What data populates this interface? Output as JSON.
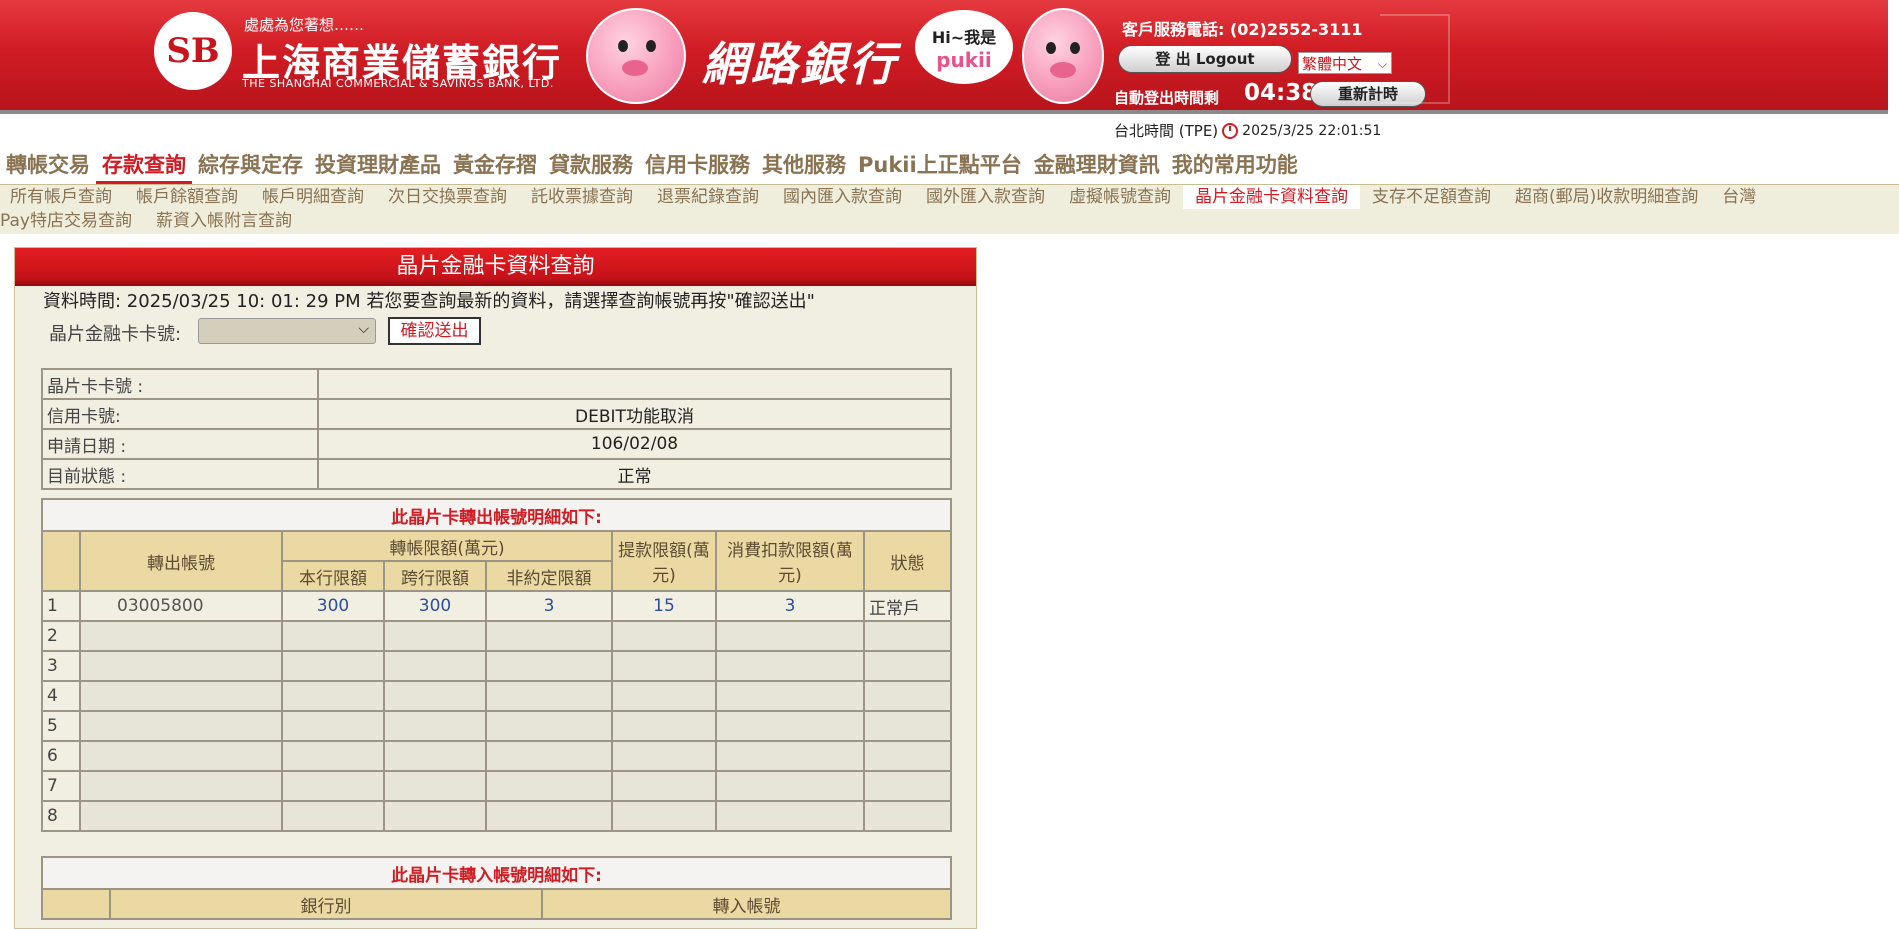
{
  "banner": {
    "logo_mark": "SB",
    "slogan": "處處為您著想……",
    "bank_name_zh": "上海商業儲蓄銀行",
    "bank_name_en": "THE SHANGHAI COMMERCIAL & SAVINGS BANK, LTD.",
    "netbank_title": "網路銀行",
    "bubble_hi": "Hi~我是",
    "bubble_brand": "pukii",
    "service_phone": "客戶服務電話: (02)2552-3111",
    "logout_label": "登 出  Logout",
    "language": "繁體中文",
    "auto_logout_label": "自動登出時間剩",
    "countdown": "04:38",
    "restart_label": "重新計時"
  },
  "clock": {
    "zone_label": "台北時間 (TPE)",
    "datetime": "2025/3/25 22:01:51"
  },
  "main_nav": [
    {
      "label": "轉帳交易",
      "active": false
    },
    {
      "label": "存款查詢",
      "active": true
    },
    {
      "label": "綜存與定存",
      "active": false
    },
    {
      "label": "投資理財產品",
      "active": false
    },
    {
      "label": "黃金存摺",
      "active": false
    },
    {
      "label": "貸款服務",
      "active": false
    },
    {
      "label": "信用卡服務",
      "active": false
    },
    {
      "label": "其他服務",
      "active": false
    },
    {
      "label": "Pukii上正點平台",
      "active": false
    },
    {
      "label": "金融理財資訊",
      "active": false
    },
    {
      "label": "我的常用功能",
      "active": false
    }
  ],
  "sub_nav": {
    "row1": [
      "所有帳戶查詢",
      "帳戶餘額查詢",
      "帳戶明細查詢",
      "次日交換票查詢",
      "託收票據查詢",
      "退票紀錄查詢",
      "國內匯入款查詢",
      "國外匯入款查詢",
      "虛擬帳號查詢",
      "晶片金融卡資料查詢",
      "支存不足額查詢",
      "超商(郵局)收款明細查詢",
      "台灣"
    ],
    "row2": [
      "Pay特店交易查詢",
      "薪資入帳附言查詢"
    ],
    "active": "晶片金融卡資料查詢"
  },
  "panel": {
    "title": "晶片金融卡資料查詢",
    "data_time": "資料時間: 2025/03/25  10: 01: 29  PM 若您要查詢最新的資料，請選擇查詢帳號再按\"確認送出\"",
    "card_label": "晶片金融卡卡號:",
    "card_selected": "",
    "confirm_label": "確認送出"
  },
  "card_info": [
    {
      "label": "晶片卡卡號 :",
      "value": ""
    },
    {
      "label": "信用卡號:",
      "value": "DEBIT功能取消"
    },
    {
      "label": "申請日期 :",
      "value": "106/02/08"
    },
    {
      "label": "目前狀態 :",
      "value": "正常"
    }
  ],
  "transfer_out": {
    "caption": "此晶片卡轉出帳號明細如下:",
    "headers": {
      "account": "轉出帳號",
      "transfer_limit": "轉帳限額(萬元)",
      "own_bank": "本行限額",
      "inter_bank": "跨行限額",
      "non_designated": "非約定限額",
      "withdraw_limit": "提款限額(萬元)",
      "purchase_limit": "消費扣款限額(萬元)",
      "status": "狀態"
    },
    "rows": [
      {
        "index": "1",
        "account": "03005800",
        "own": "300",
        "inter": "300",
        "non": "3",
        "withdraw": "15",
        "purchase": "3",
        "status": "正常戶"
      },
      {
        "index": "2"
      },
      {
        "index": "3"
      },
      {
        "index": "4"
      },
      {
        "index": "5"
      },
      {
        "index": "6"
      },
      {
        "index": "7"
      },
      {
        "index": "8"
      }
    ]
  },
  "transfer_in": {
    "caption": "此晶片卡轉入帳號明細如下:",
    "headers": {
      "bank": "銀行別",
      "account": "轉入帳號"
    }
  },
  "colors": {
    "brand_red": "#d11c24",
    "nav_brown": "#8a7352",
    "header_tan": "#ead9a2",
    "value_blue": "#2c4f9c"
  }
}
